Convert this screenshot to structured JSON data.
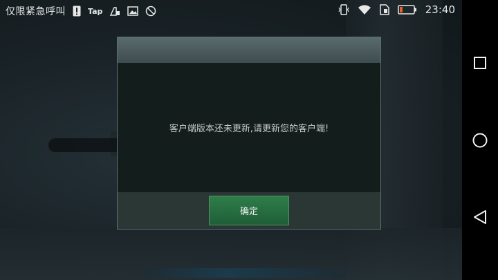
{
  "status_bar": {
    "carrier": "仅限紧急呼叫",
    "tap_label": "Tap",
    "time": "23:40",
    "left_icons": [
      "warning-icon",
      "tap-icon",
      "usb-battery-icon",
      "image-icon",
      "no-sign-icon"
    ],
    "right_icons": [
      "vibrate-icon",
      "wifi-icon",
      "sim-icon",
      "battery-low-icon"
    ],
    "battery_color": "#e8612c"
  },
  "dialog": {
    "title": "",
    "message": "客户端版本还未更新,请更新您的客户端!",
    "confirm_label": "确定",
    "accent": "#2f7d4a"
  },
  "nav_bar": {
    "buttons": [
      "recents-square-icon",
      "home-circle-icon",
      "back-triangle-icon"
    ]
  }
}
